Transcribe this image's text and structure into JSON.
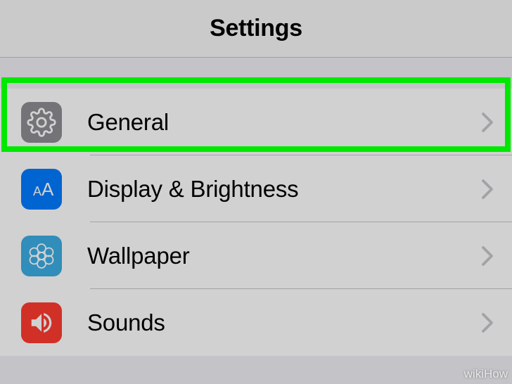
{
  "header": {
    "title": "Settings"
  },
  "rows": {
    "general": {
      "label": "General"
    },
    "display": {
      "label": "Display & Brightness"
    },
    "wallpaper": {
      "label": "Wallpaper"
    },
    "sounds": {
      "label": "Sounds"
    }
  },
  "watermark": "wikiHow"
}
